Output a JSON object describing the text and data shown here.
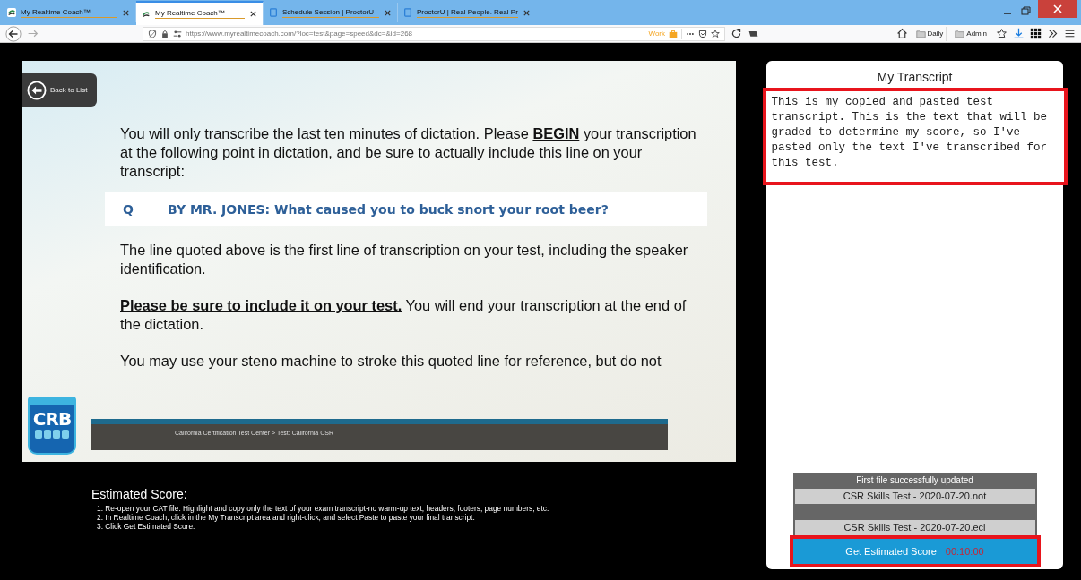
{
  "browser": {
    "tabs": [
      {
        "title": "My Realtime Coach™",
        "kind": "coach",
        "selected": false
      },
      {
        "title": "My Realtime Coach™",
        "kind": "coach",
        "selected": true
      },
      {
        "title": "Schedule Session | ProctorU",
        "kind": "proctor",
        "selected": false
      },
      {
        "title": "ProctorU | Real People. Real Pr",
        "kind": "proctor",
        "selected": false
      }
    ],
    "url": "https://www.myrealtimecoach.com/?loc=test&page=speed&dc=&id=268",
    "container_label": "Work",
    "bookmarks": [
      "Daily",
      "Admin"
    ]
  },
  "slide": {
    "back_button": "Back to List",
    "intro": "You will only transcribe the last ten minutes of dictation. Please **BEGIN** your transcription at the following point in dictation, and be sure to actually include this line on your transcript:",
    "quote": {
      "speaker": "Q",
      "text": "BY MR. JONES: What caused you to buck snort your root beer?"
    },
    "paragraphs": [
      "The line quoted above is the first line of transcription on your test, including the speaker identification.",
      "**Please be sure to include it on your test.** You will end your transcription at the end of the dictation.",
      "You may use your steno machine to stroke this quoted line for reference, but do not"
    ],
    "logo": "CRB",
    "breadcrumb": "California Certification Test Center > Test: California CSR"
  },
  "instructions": {
    "heading": "Estimated Score:",
    "steps": [
      "1. Re-open your CAT file. Highlight and copy only the text of your exam transcript-no warm-up text, headers, footers, page numbers, etc.",
      "2. In Realtime Coach, click in the My Transcript area and right-click, and select Paste to paste your final transcript.",
      "3. Click Get Estimated Score."
    ]
  },
  "transcript": {
    "title": "My Transcript",
    "value": "This is my copied and pasted test transcript. This is the text that will be graded to determine my score, so I've pasted only the text I've transcribed for this test."
  },
  "files": {
    "status": "First file successfully updated",
    "items": [
      "CSR Skills Test - 2020-07-20.not",
      "CSR Skills Test - 2020-07-20.ecl"
    ]
  },
  "score_button": {
    "label": "Get Estimated Score",
    "timer": "00:10:00"
  }
}
